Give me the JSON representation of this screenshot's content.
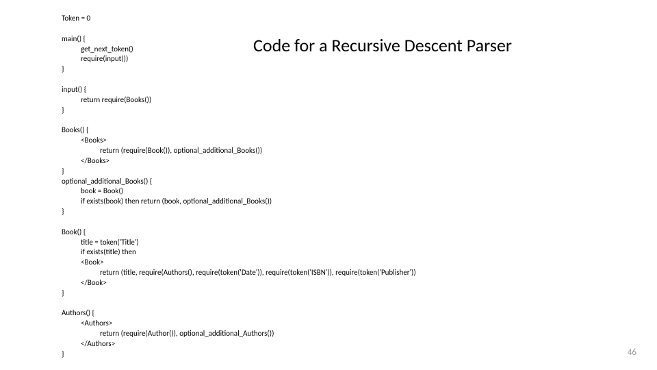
{
  "title": "Code for a Recursive Descent Parser",
  "page_number": "46",
  "code": {
    "l01": "Token = 0",
    "l02": "",
    "l03": "main() {",
    "l04": "get_next_token()",
    "l05": "require(input())",
    "l06": "}",
    "l07": "",
    "l08": "input() {",
    "l09": "return require(Books())",
    "l10": "}",
    "l11": "",
    "l12": "Books() {",
    "l13": "<Books>",
    "l14": "return (require(Book()), optional_additional_Books())",
    "l15": "</Books>",
    "l16": "}",
    "l17": "optional_additional_Books() {",
    "l18": "book = Book()",
    "l19": "if exists(book) then return (book, optional_additional_Books())",
    "l20": "}",
    "l21": "",
    "l22": "Book() {",
    "l23": "title = token('Title')",
    "l24": "if exists(title) then",
    "l25": "<Book>",
    "l26": "return (title, require(Authors(), require(token('Date')), require(token('ISBN')), require(token('Publisher'))",
    "l27": "</Book>",
    "l28": "}",
    "l29": "",
    "l30": "Authors() {",
    "l31": "<Authors>",
    "l32": "return (require(Author()), optional_additional_Authors())",
    "l33": "</Authors>",
    "l34": "}"
  }
}
